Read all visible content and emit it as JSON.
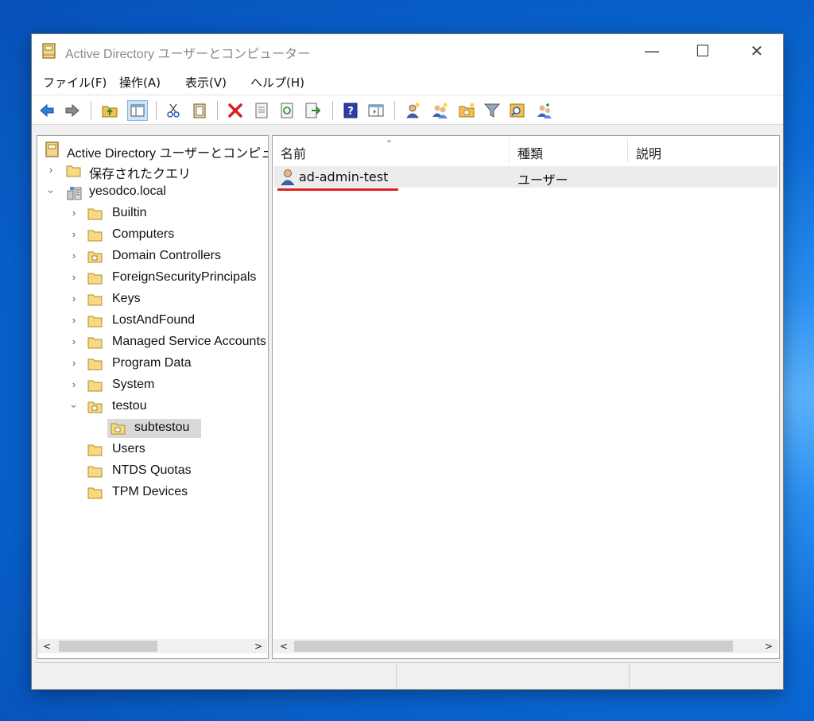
{
  "window": {
    "title": "Active Directory ユーザーとコンピューター",
    "controls": {
      "minimize": "—",
      "maximize": "☐",
      "close": "✕"
    }
  },
  "menu": [
    {
      "label": "ファイル(F)"
    },
    {
      "label": "操作(A)"
    },
    {
      "label": "表示(V)"
    },
    {
      "label": "ヘルプ(H)"
    }
  ],
  "toolbar": {
    "icons": [
      "back-icon",
      "forward-icon",
      "up-folder-icon",
      "show-console-tree-icon",
      "cut-icon",
      "copy-icon",
      "delete-icon",
      "properties-icon",
      "refresh-icon",
      "export-list-icon",
      "help-icon",
      "show-action-pane-icon",
      "new-user-icon",
      "new-group-icon",
      "new-ou-icon",
      "filter-icon",
      "find-icon",
      "add-to-group-icon"
    ]
  },
  "tree": {
    "root": "Active Directory ユーザーとコンピュータ",
    "saved_queries": "保存されたクエリ",
    "domain": "yesodco.local",
    "items": [
      {
        "label": "Builtin"
      },
      {
        "label": "Computers"
      },
      {
        "label": "Domain Controllers"
      },
      {
        "label": "ForeignSecurityPrincipals"
      },
      {
        "label": "Keys"
      },
      {
        "label": "LostAndFound"
      },
      {
        "label": "Managed Service Accounts"
      },
      {
        "label": "Program Data"
      },
      {
        "label": "System"
      },
      {
        "label": "testou"
      },
      {
        "label": "subtestou"
      },
      {
        "label": "Users"
      },
      {
        "label": "NTDS Quotas"
      },
      {
        "label": "TPM Devices"
      }
    ]
  },
  "list": {
    "columns": {
      "name": "名前",
      "type": "種類",
      "description": "説明"
    },
    "rows": [
      {
        "name": "ad-admin-test",
        "type": "ユーザー",
        "description": ""
      }
    ]
  },
  "scroll": {
    "left": "<",
    "right": ">"
  },
  "colors": {
    "accent_underline": "#e02020",
    "folder": "#f2c14e",
    "selection": "#d9d9d9"
  }
}
